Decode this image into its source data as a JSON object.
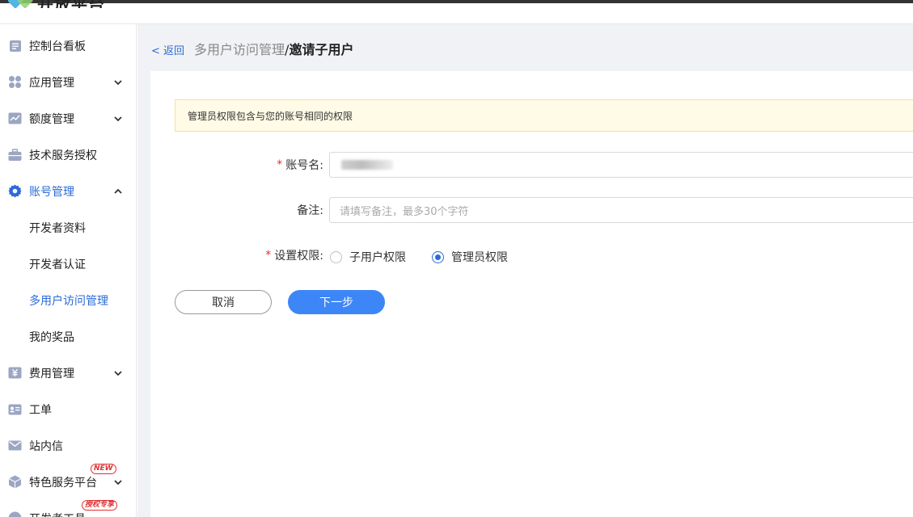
{
  "app": {
    "logo_text": "开放平台"
  },
  "sidebar": {
    "items": [
      {
        "label": "控制台看板",
        "icon": "dashboard-icon",
        "expandable": false
      },
      {
        "label": "应用管理",
        "icon": "apps-icon",
        "expandable": true
      },
      {
        "label": "额度管理",
        "icon": "quota-chart-icon",
        "expandable": true
      },
      {
        "label": "技术服务授权",
        "icon": "briefcase-icon",
        "expandable": false
      },
      {
        "label": "账号管理",
        "icon": "gear-icon",
        "expandable": true,
        "expanded": true,
        "active": true
      }
    ],
    "sub_items": [
      {
        "label": "开发者资料"
      },
      {
        "label": "开发者认证"
      },
      {
        "label": "多用户访问管理",
        "current": true
      },
      {
        "label": "我的奖品"
      }
    ],
    "items_after": [
      {
        "label": "费用管理",
        "icon": "yen-icon",
        "expandable": true
      },
      {
        "label": "工单",
        "icon": "ticket-icon",
        "expandable": false
      },
      {
        "label": "站内信",
        "icon": "mail-icon",
        "expandable": false
      },
      {
        "label": "特色服务平台",
        "icon": "cube-icon",
        "expandable": true,
        "badge": "NEW"
      },
      {
        "label": "开发者工具",
        "icon": "tools-icon",
        "expandable": true,
        "badge": "授权专享"
      }
    ]
  },
  "breadcrumb": {
    "back_label": "< 返回",
    "parent": "多用户访问管理",
    "separator": "/",
    "current": "邀请子用户"
  },
  "notice": {
    "text": "管理员权限包含与您的账号相同的权限"
  },
  "form": {
    "account": {
      "label": "账号名:",
      "required": true,
      "value_hidden": true
    },
    "remark": {
      "label": "备注:",
      "placeholder": "请填写备注，最多30个字符",
      "value": ""
    },
    "permission": {
      "label": "设置权限:",
      "required": true,
      "options": [
        {
          "label": "子用户权限",
          "checked": false
        },
        {
          "label": "管理员权限",
          "checked": true
        }
      ]
    }
  },
  "buttons": {
    "cancel": "取消",
    "next": "下一步"
  },
  "colors": {
    "accent": "#2a6bd6",
    "primary_button": "#3d86f7",
    "notice_bg": "#fffbe6",
    "required": "#e03131"
  }
}
